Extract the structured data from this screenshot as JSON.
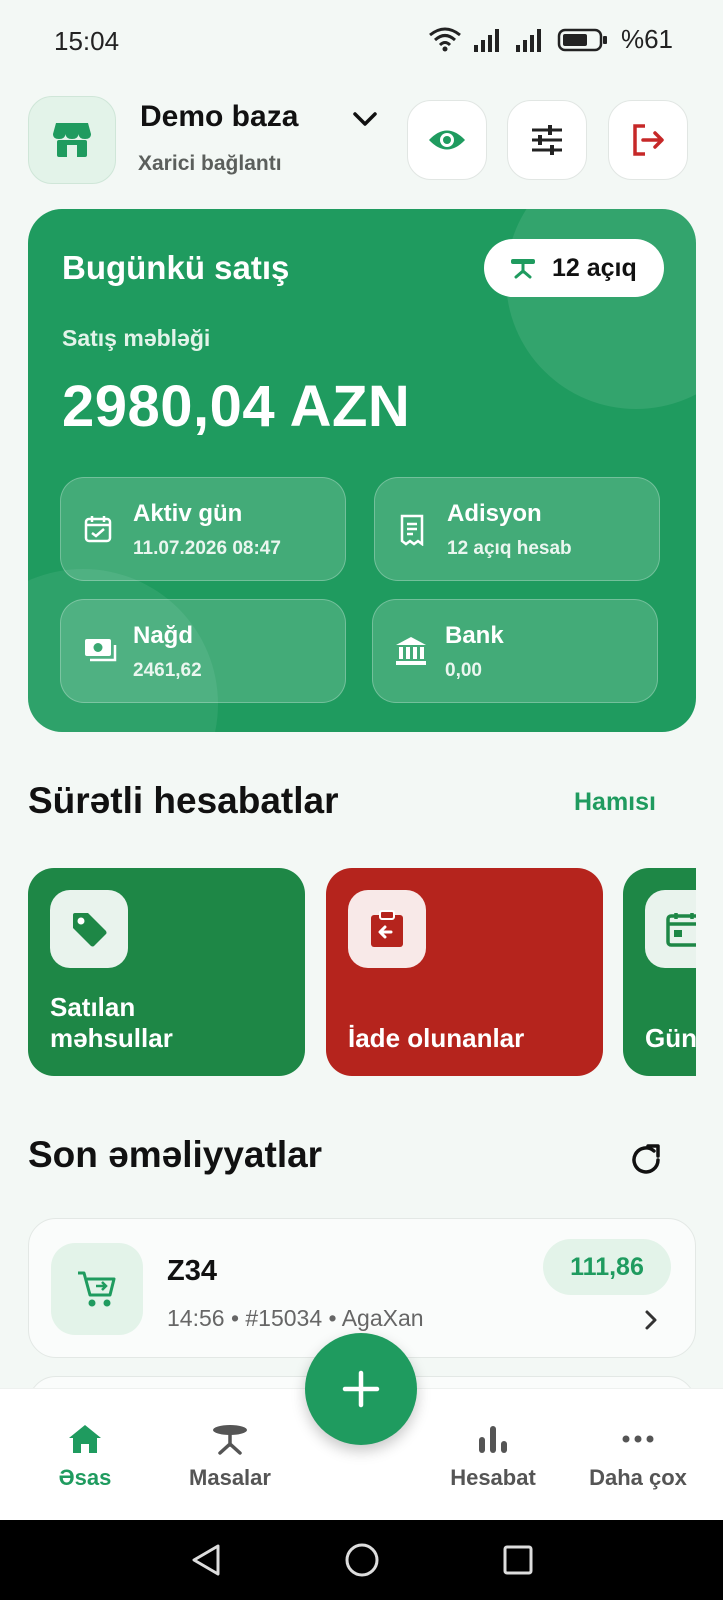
{
  "status_bar": {
    "time": "15:04",
    "battery": "%61"
  },
  "header": {
    "db_name": "Demo baza",
    "connection": "Xarici bağlantı"
  },
  "sales": {
    "title": "Bugünkü satış",
    "open_badge": "12 açıq",
    "amount_label": "Satış məbləği",
    "amount": "2980,04 AZN",
    "tiles": [
      {
        "title": "Aktiv gün",
        "value": "11.07.2026 08:47"
      },
      {
        "title": "Adisyon",
        "value": "12 açıq hesab"
      },
      {
        "title": "Nağd",
        "value": "2461,62"
      },
      {
        "title": "Bank",
        "value": "0,00"
      }
    ]
  },
  "quick_reports": {
    "title": "Sürətli hesabatlar",
    "see_all": "Hamısı",
    "items": [
      {
        "label_line1": "Satılan",
        "label_line2": "məhsullar"
      },
      {
        "label_line1": "",
        "label_line2": "İade olunanlar"
      },
      {
        "label_line1": "",
        "label_line2": "Gün"
      }
    ]
  },
  "recent": {
    "title": "Son əməliyyatlar",
    "items": [
      {
        "title": "Z34",
        "meta": "14:56 • #15034 • AgaXan",
        "amount": "111,86"
      }
    ]
  },
  "bottom_nav": {
    "items": [
      {
        "label": "Əsas"
      },
      {
        "label": "Masalar"
      },
      {
        "label": "Hesabat"
      },
      {
        "label": "Daha çox"
      }
    ]
  },
  "colors": {
    "primary": "#1f9b5f",
    "report_green": "#1e8746",
    "report_red": "#b5241d",
    "logout_red": "#c62828"
  }
}
